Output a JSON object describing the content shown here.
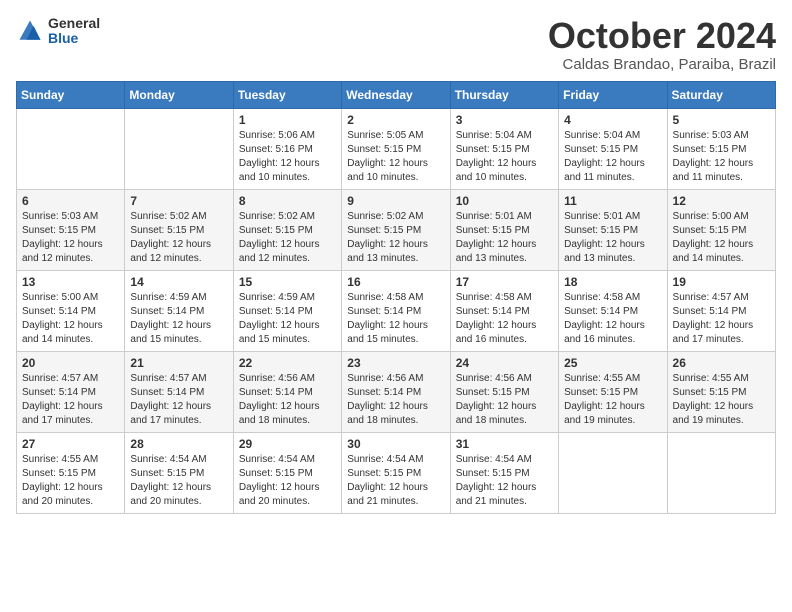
{
  "logo": {
    "general": "General",
    "blue": "Blue"
  },
  "title": "October 2024",
  "subtitle": "Caldas Brandao, Paraiba, Brazil",
  "days_header": [
    "Sunday",
    "Monday",
    "Tuesday",
    "Wednesday",
    "Thursday",
    "Friday",
    "Saturday"
  ],
  "weeks": [
    [
      {
        "day": "",
        "info": ""
      },
      {
        "day": "",
        "info": ""
      },
      {
        "day": "1",
        "info": "Sunrise: 5:06 AM\nSunset: 5:16 PM\nDaylight: 12 hours\nand 10 minutes."
      },
      {
        "day": "2",
        "info": "Sunrise: 5:05 AM\nSunset: 5:15 PM\nDaylight: 12 hours\nand 10 minutes."
      },
      {
        "day": "3",
        "info": "Sunrise: 5:04 AM\nSunset: 5:15 PM\nDaylight: 12 hours\nand 10 minutes."
      },
      {
        "day": "4",
        "info": "Sunrise: 5:04 AM\nSunset: 5:15 PM\nDaylight: 12 hours\nand 11 minutes."
      },
      {
        "day": "5",
        "info": "Sunrise: 5:03 AM\nSunset: 5:15 PM\nDaylight: 12 hours\nand 11 minutes."
      }
    ],
    [
      {
        "day": "6",
        "info": "Sunrise: 5:03 AM\nSunset: 5:15 PM\nDaylight: 12 hours\nand 12 minutes."
      },
      {
        "day": "7",
        "info": "Sunrise: 5:02 AM\nSunset: 5:15 PM\nDaylight: 12 hours\nand 12 minutes."
      },
      {
        "day": "8",
        "info": "Sunrise: 5:02 AM\nSunset: 5:15 PM\nDaylight: 12 hours\nand 12 minutes."
      },
      {
        "day": "9",
        "info": "Sunrise: 5:02 AM\nSunset: 5:15 PM\nDaylight: 12 hours\nand 13 minutes."
      },
      {
        "day": "10",
        "info": "Sunrise: 5:01 AM\nSunset: 5:15 PM\nDaylight: 12 hours\nand 13 minutes."
      },
      {
        "day": "11",
        "info": "Sunrise: 5:01 AM\nSunset: 5:15 PM\nDaylight: 12 hours\nand 13 minutes."
      },
      {
        "day": "12",
        "info": "Sunrise: 5:00 AM\nSunset: 5:15 PM\nDaylight: 12 hours\nand 14 minutes."
      }
    ],
    [
      {
        "day": "13",
        "info": "Sunrise: 5:00 AM\nSunset: 5:14 PM\nDaylight: 12 hours\nand 14 minutes."
      },
      {
        "day": "14",
        "info": "Sunrise: 4:59 AM\nSunset: 5:14 PM\nDaylight: 12 hours\nand 15 minutes."
      },
      {
        "day": "15",
        "info": "Sunrise: 4:59 AM\nSunset: 5:14 PM\nDaylight: 12 hours\nand 15 minutes."
      },
      {
        "day": "16",
        "info": "Sunrise: 4:58 AM\nSunset: 5:14 PM\nDaylight: 12 hours\nand 15 minutes."
      },
      {
        "day": "17",
        "info": "Sunrise: 4:58 AM\nSunset: 5:14 PM\nDaylight: 12 hours\nand 16 minutes."
      },
      {
        "day": "18",
        "info": "Sunrise: 4:58 AM\nSunset: 5:14 PM\nDaylight: 12 hours\nand 16 minutes."
      },
      {
        "day": "19",
        "info": "Sunrise: 4:57 AM\nSunset: 5:14 PM\nDaylight: 12 hours\nand 17 minutes."
      }
    ],
    [
      {
        "day": "20",
        "info": "Sunrise: 4:57 AM\nSunset: 5:14 PM\nDaylight: 12 hours\nand 17 minutes."
      },
      {
        "day": "21",
        "info": "Sunrise: 4:57 AM\nSunset: 5:14 PM\nDaylight: 12 hours\nand 17 minutes."
      },
      {
        "day": "22",
        "info": "Sunrise: 4:56 AM\nSunset: 5:14 PM\nDaylight: 12 hours\nand 18 minutes."
      },
      {
        "day": "23",
        "info": "Sunrise: 4:56 AM\nSunset: 5:14 PM\nDaylight: 12 hours\nand 18 minutes."
      },
      {
        "day": "24",
        "info": "Sunrise: 4:56 AM\nSunset: 5:15 PM\nDaylight: 12 hours\nand 18 minutes."
      },
      {
        "day": "25",
        "info": "Sunrise: 4:55 AM\nSunset: 5:15 PM\nDaylight: 12 hours\nand 19 minutes."
      },
      {
        "day": "26",
        "info": "Sunrise: 4:55 AM\nSunset: 5:15 PM\nDaylight: 12 hours\nand 19 minutes."
      }
    ],
    [
      {
        "day": "27",
        "info": "Sunrise: 4:55 AM\nSunset: 5:15 PM\nDaylight: 12 hours\nand 20 minutes."
      },
      {
        "day": "28",
        "info": "Sunrise: 4:54 AM\nSunset: 5:15 PM\nDaylight: 12 hours\nand 20 minutes."
      },
      {
        "day": "29",
        "info": "Sunrise: 4:54 AM\nSunset: 5:15 PM\nDaylight: 12 hours\nand 20 minutes."
      },
      {
        "day": "30",
        "info": "Sunrise: 4:54 AM\nSunset: 5:15 PM\nDaylight: 12 hours\nand 21 minutes."
      },
      {
        "day": "31",
        "info": "Sunrise: 4:54 AM\nSunset: 5:15 PM\nDaylight: 12 hours\nand 21 minutes."
      },
      {
        "day": "",
        "info": ""
      },
      {
        "day": "",
        "info": ""
      }
    ]
  ]
}
